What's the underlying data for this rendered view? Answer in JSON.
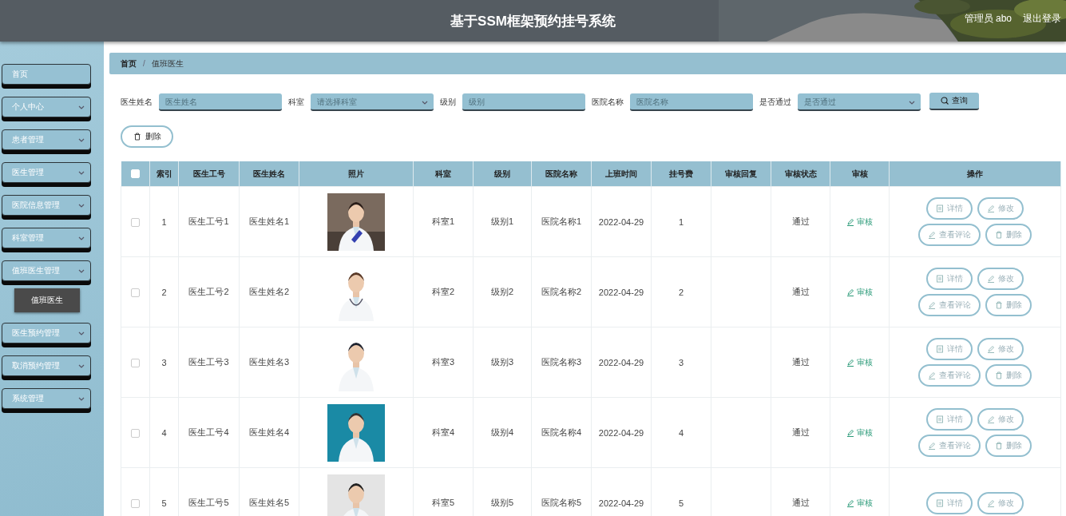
{
  "header": {
    "title": "基于SSM框架预约挂号系统",
    "user": "管理员 abo",
    "logout": "退出登录"
  },
  "sidebar": {
    "items": [
      {
        "label": "首页",
        "kind": "link"
      },
      {
        "label": "个人中心",
        "kind": "menu"
      },
      {
        "label": "患者管理",
        "kind": "menu"
      },
      {
        "label": "医生管理",
        "kind": "menu"
      },
      {
        "label": "医院信息管理",
        "kind": "menu"
      },
      {
        "label": "科室管理",
        "kind": "menu"
      },
      {
        "label": "值班医生管理",
        "kind": "menu",
        "children": [
          {
            "label": "值班医生",
            "selected": true
          }
        ]
      },
      {
        "label": "医生预约管理",
        "kind": "menu"
      },
      {
        "label": "取消预约管理",
        "kind": "menu"
      },
      {
        "label": "系统管理",
        "kind": "menu"
      }
    ]
  },
  "breadcrumb": [
    "首页",
    "值班医生"
  ],
  "breadcrumb_separator": "/",
  "search": {
    "fields": [
      {
        "label": "医生姓名",
        "placeholder": "医生姓名",
        "kind": "input"
      },
      {
        "label": "科室",
        "placeholder": "请选择科室",
        "kind": "select"
      },
      {
        "label": "级别",
        "placeholder": "级别",
        "kind": "input"
      },
      {
        "label": "医院名称",
        "placeholder": "医院名称",
        "kind": "input"
      },
      {
        "label": "是否通过",
        "placeholder": "是否通过",
        "kind": "select"
      }
    ],
    "button": "查询"
  },
  "toolbar": {
    "delete_button": "删除"
  },
  "table": {
    "header_checked": false,
    "columns": [
      "索引",
      "医生工号",
      "医生姓名",
      "照片",
      "科室",
      "级别",
      "医院名称",
      "上班时间",
      "挂号费",
      "审核回复",
      "审核状态",
      "审核",
      "操作"
    ],
    "rows": [
      {
        "checked": false,
        "index": "1",
        "doctor_no": "医生工号1",
        "doctor_name": "医生姓名1",
        "photo": {
          "kind": "picture"
        },
        "department": "科室1",
        "grade": "级别1",
        "hospital": "医院名称1",
        "shift_date": "2022-04-29",
        "fee": "1",
        "review_status": "通过",
        "review_link": "审核",
        "actions": [
          {
            "label": "详情",
            "kind": "detail"
          },
          {
            "label": "修改",
            "kind": "edit"
          },
          {
            "label": "查看评论",
            "kind": "comment"
          },
          {
            "label": "删除",
            "kind": "delete"
          }
        ]
      },
      {
        "checked": false,
        "index": "2",
        "doctor_no": "医生工号2",
        "doctor_name": "医生姓名2",
        "photo": {
          "kind": "picture"
        },
        "department": "科室2",
        "grade": "级别2",
        "hospital": "医院名称2",
        "shift_date": "2022-04-29",
        "fee": "2",
        "review_status": "通过",
        "review_link": "审核",
        "actions": [
          {
            "label": "详情",
            "kind": "detail"
          },
          {
            "label": "修改",
            "kind": "edit"
          },
          {
            "label": "查看评论",
            "kind": "comment"
          },
          {
            "label": "删除",
            "kind": "delete"
          }
        ]
      },
      {
        "checked": false,
        "index": "3",
        "doctor_no": "医生工号3",
        "doctor_name": "医生姓名3",
        "photo": {
          "kind": "picture"
        },
        "department": "科室3",
        "grade": "级别3",
        "hospital": "医院名称3",
        "shift_date": "2022-04-29",
        "fee": "3",
        "review_status": "通过",
        "review_link": "审核",
        "actions": [
          {
            "label": "详情",
            "kind": "detail"
          },
          {
            "label": "修改",
            "kind": "edit"
          },
          {
            "label": "查看评论",
            "kind": "comment"
          },
          {
            "label": "删除",
            "kind": "delete"
          }
        ]
      },
      {
        "checked": false,
        "index": "4",
        "doctor_no": "医生工号4",
        "doctor_name": "医生姓名4",
        "photo": {
          "kind": "picture"
        },
        "department": "科室4",
        "grade": "级别4",
        "hospital": "医院名称4",
        "shift_date": "2022-04-29",
        "fee": "4",
        "review_status": "通过",
        "review_link": "审核",
        "actions": [
          {
            "label": "详情",
            "kind": "detail"
          },
          {
            "label": "修改",
            "kind": "edit"
          },
          {
            "label": "查看评论",
            "kind": "comment"
          },
          {
            "label": "删除",
            "kind": "delete"
          }
        ]
      },
      {
        "checked": false,
        "index": "5",
        "doctor_no": "医生工号5",
        "doctor_name": "医生姓名5",
        "photo": {
          "kind": "picture"
        },
        "department": "科室5",
        "grade": "级别5",
        "hospital": "医院名称5",
        "shift_date": "2022-04-29",
        "fee": "5",
        "review_status": "通过",
        "review_link": "审核",
        "actions": [
          {
            "label": "详情",
            "kind": "detail"
          },
          {
            "label": "修改",
            "kind": "edit"
          }
        ]
      }
    ]
  }
}
